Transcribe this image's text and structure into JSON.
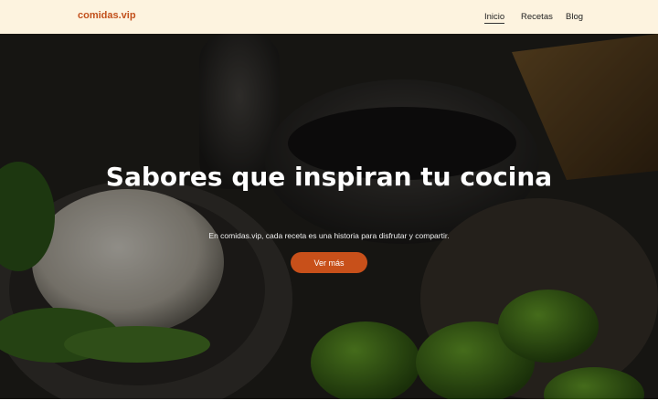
{
  "header": {
    "brand": "comidas.vip",
    "nav": [
      {
        "label": "Inicio",
        "active": true
      },
      {
        "label": "Recetas",
        "active": false
      },
      {
        "label": "Blog",
        "active": false
      }
    ]
  },
  "hero": {
    "title": "Sabores que inspiran tu cocina",
    "subtitle": "En comidas.vip, cada receta es una historia para disfrutar y compartir.",
    "cta_label": "Ver más"
  },
  "colors": {
    "accent": "#c8501a",
    "header_bg": "#fdf3df",
    "brand_text": "#c2501c"
  }
}
